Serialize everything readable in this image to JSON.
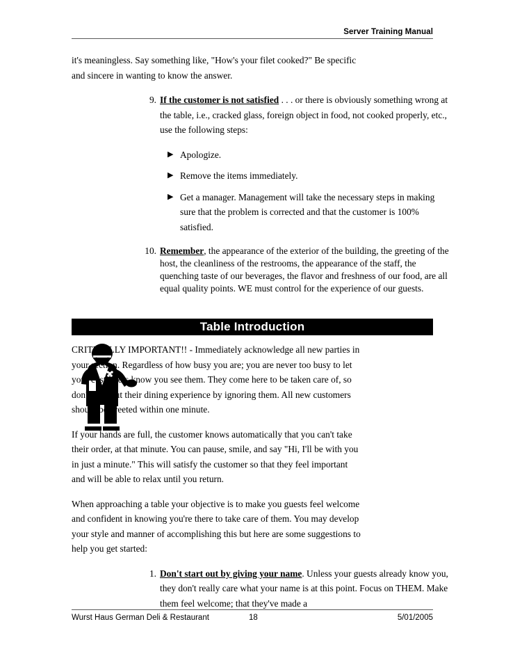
{
  "header": {
    "title": "Server Training Manual"
  },
  "content": {
    "continued_paragraph": "it's meaningless. Say something like, \"How's your filet cooked?\" Be specific and sincere in wanting to know the answer.",
    "numbered_items": [
      {
        "marker": "9.",
        "lead_in": "If the customer is not satisfied",
        "text": " . . . or there is obviously something wrong at the table, i.e., cracked glass, foreign object in food, not cooked properly, etc., use the following steps:"
      },
      {
        "marker": "10.",
        "lead_in": "Remember",
        "text": ", the appearance of the exterior of the building, the greeting of the host, the cleanliness of the restrooms, the appearance of the staff, the quenching taste of our beverages, the flavor and freshness of our food, are all equal quality points. WE must control for the experience of our guests."
      }
    ],
    "bullets": [
      "Apologize.",
      "Remove the items immediately.",
      "Get a manager. Management will take the necessary steps in making sure that the problem is corrected and that the customer is 100% satisfied."
    ],
    "bullet_glyph": "▶"
  },
  "section": {
    "banner_title": "Table Introduction",
    "banner_bg": "#000000",
    "banner_color": "#ffffff"
  },
  "table_intro": {
    "paragraphs": [
      "CRITICALLY IMPORTANT!! - Immediately acknowledge all new parties in your section. Regardless of how busy you are; you are never too busy to let your customers know you see them. They come here to be taken care of, so don't start out their dining experience by ignoring them. All new customers should be greeted within one minute.",
      "If your hands are full, the customer knows automatically that you can't take their order, at that minute. You can pause, smile, and say \"Hi, I'll be with you in just a minute.\" This will satisfy the customer so that they feel important and will be able to relax until you return.",
      "When approaching a table your objective is to make you guests feel welcome and confident in knowing you're there to take care of them. You may develop your style and manner of accomplishing this but here are some suggestions to help you get started:"
    ],
    "suggestions": [
      {
        "marker": "1.",
        "lead_in": "Don't start out by giving your name",
        "text": ". Unless your guests already know you, they don't really care what your name is at this point. Focus on THEM. Make them feel welcome; that they've made a"
      }
    ]
  },
  "illustration": {
    "name": "waiter-silhouette"
  },
  "footer": {
    "restaurant": "Wurst Haus German Deli & Restaurant",
    "page_number": "18",
    "date": "5/01/2005"
  }
}
